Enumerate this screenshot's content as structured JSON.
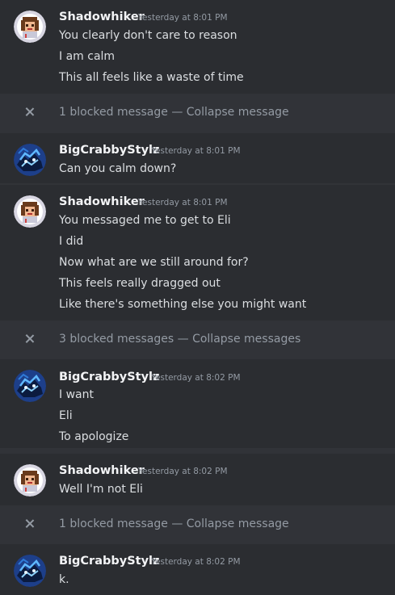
{
  "messages": [
    {
      "author": "Shadowhiker",
      "avatar": "shadowhiker-avatar",
      "timestamp": "Yesterday at 8:01 PM",
      "lines": [
        "You clearly don't care to reason",
        "I am calm",
        "This all feels like a waste of time"
      ]
    },
    {
      "author": "BigCrabbyStylz",
      "avatar": "bigcrabbystylz-avatar",
      "timestamp": "Yesterday at 8:01 PM",
      "lines": [
        "Can you calm down?"
      ]
    },
    {
      "author": "Shadowhiker",
      "avatar": "shadowhiker-avatar",
      "timestamp": "Yesterday at 8:01 PM",
      "lines": [
        "You messaged me to get to Eli",
        "I did",
        "Now what are we still around for?",
        "This feels really dragged out",
        "Like there's something else you might want"
      ]
    },
    {
      "author": "BigCrabbyStylz",
      "avatar": "bigcrabbystylz-avatar",
      "timestamp": "Yesterday at 8:02 PM",
      "lines": [
        "I want",
        "Eli",
        "To apologize"
      ]
    },
    {
      "author": "Shadowhiker",
      "avatar": "shadowhiker-avatar",
      "timestamp": "Yesterday at 8:02 PM",
      "lines": [
        "Well I'm not Eli"
      ]
    },
    {
      "author": "BigCrabbyStylz",
      "avatar": "bigcrabbystylz-avatar",
      "timestamp": "Yesterday at 8:02 PM",
      "lines": [
        "k."
      ]
    }
  ],
  "blocked": [
    {
      "count_label": "1 blocked message",
      "separator": "—",
      "action": "Collapse message"
    },
    {
      "count_label": "3 blocked messages",
      "separator": "—",
      "action": "Collapse messages"
    },
    {
      "count_label": "1 blocked message",
      "separator": "—",
      "action": "Collapse message"
    }
  ],
  "colors": {
    "background": "#313338",
    "highlight_background": "#2b2d31",
    "username": "#f2f3f5",
    "text": "#dbdee1",
    "muted": "#949ba4"
  }
}
